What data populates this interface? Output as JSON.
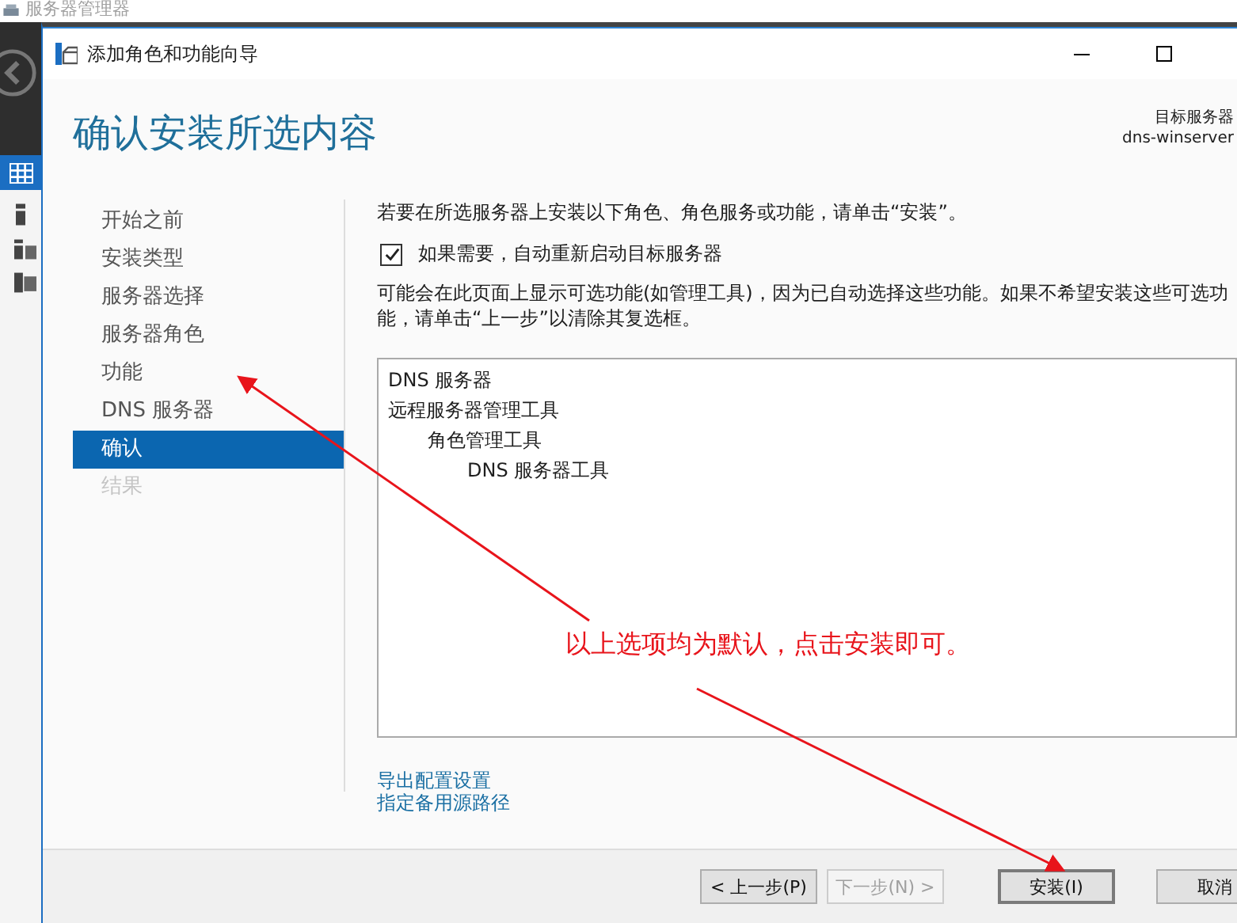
{
  "background_window": {
    "title": "服务器管理器"
  },
  "window": {
    "title": "添加角色和功能向导"
  },
  "heading": "确认安装所选内容",
  "target_server": {
    "label": "目标服务器",
    "name": "dns-winserver"
  },
  "steps": [
    {
      "label": "开始之前",
      "selected": false,
      "disabled": false
    },
    {
      "label": "安装类型",
      "selected": false,
      "disabled": false
    },
    {
      "label": "服务器选择",
      "selected": false,
      "disabled": false
    },
    {
      "label": "服务器角色",
      "selected": false,
      "disabled": false
    },
    {
      "label": "功能",
      "selected": false,
      "disabled": false
    },
    {
      "label": "DNS 服务器",
      "selected": false,
      "disabled": false
    },
    {
      "label": "确认",
      "selected": true,
      "disabled": false
    },
    {
      "label": "结果",
      "selected": false,
      "disabled": true
    }
  ],
  "intro": "若要在所选服务器上安装以下角色、角色服务或功能，请单击“安装”。",
  "restart_option": {
    "label": "如果需要，自动重新启动目标服务器",
    "checked": true
  },
  "note": "可能会在此页面上显示可选功能(如管理工具)，因为已自动选择这些功能。如果不希望安装这些可选功能，请单击“上一步”以清除其复选框。",
  "selection_list": [
    {
      "label": "DNS 服务器"
    },
    {
      "label": "远程服务器管理工具",
      "children": [
        {
          "label": "角色管理工具",
          "children": [
            {
              "label": "DNS 服务器工具"
            }
          ]
        }
      ]
    }
  ],
  "links": [
    "导出配置设置",
    "指定备用源路径"
  ],
  "buttons": [
    {
      "label": "< 上一步(P)",
      "disabled": false
    },
    {
      "label": "下一步(N) >",
      "disabled": true
    },
    {
      "label": "安装(I)",
      "disabled": false
    },
    {
      "label": "取消",
      "disabled": false
    }
  ],
  "annotation": {
    "text": "以上选项均为默认，点击安装即可。"
  }
}
